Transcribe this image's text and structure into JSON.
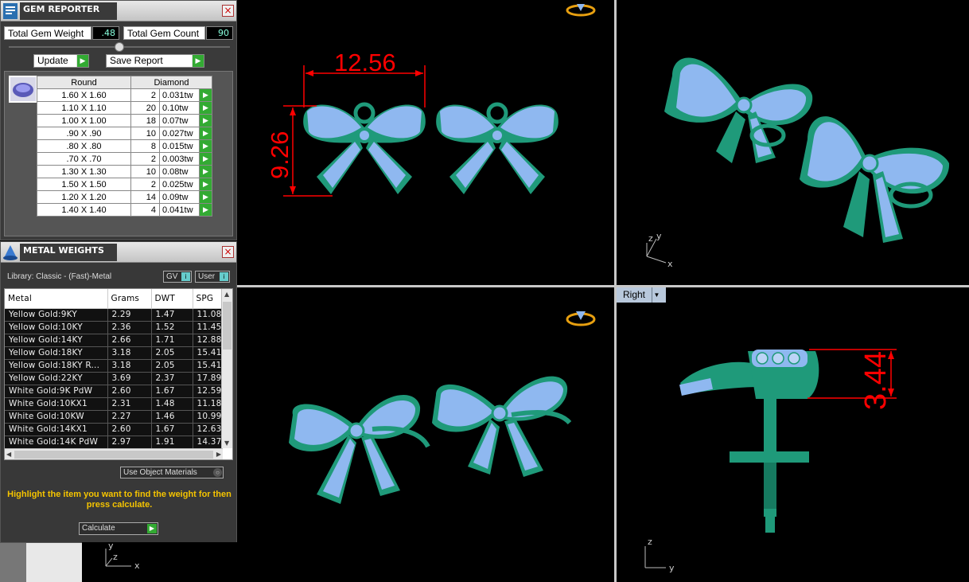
{
  "gem_reporter": {
    "title": "GEM REPORTER",
    "total_weight_label": "Total Gem Weight",
    "total_weight_value": ".48",
    "total_count_label": "Total Gem Count",
    "total_count_value": "90",
    "update_label": "Update",
    "save_report_label": "Save Report",
    "table_header_shape": "Round",
    "table_header_type": "Diamond",
    "rows": [
      {
        "size": "1.60 X 1.60",
        "count": "2",
        "tw": "0.031tw"
      },
      {
        "size": "1.10 X 1.10",
        "count": "20",
        "tw": "0.10tw"
      },
      {
        "size": "1.00 X 1.00",
        "count": "18",
        "tw": "0.07tw"
      },
      {
        "size": ".90 X .90",
        "count": "10",
        "tw": "0.027tw"
      },
      {
        "size": ".80 X .80",
        "count": "8",
        "tw": "0.015tw"
      },
      {
        "size": ".70 X .70",
        "count": "2",
        "tw": "0.003tw"
      },
      {
        "size": "1.30 X 1.30",
        "count": "10",
        "tw": "0.08tw"
      },
      {
        "size": "1.50 X 1.50",
        "count": "2",
        "tw": "0.025tw"
      },
      {
        "size": "1.20 X 1.20",
        "count": "14",
        "tw": "0.09tw"
      },
      {
        "size": "1.40 X 1.40",
        "count": "4",
        "tw": "0.041tw"
      }
    ]
  },
  "metal_weights": {
    "title": "METAL WEIGHTS",
    "library_text": "Library: Classic - (Fast)-Metal",
    "gv_label": "GV",
    "user_label": "User",
    "columns": [
      "Metal",
      "Grams",
      "DWT",
      "SPG"
    ],
    "rows": [
      {
        "metal": "Yellow Gold:9KY",
        "grams": "2.29",
        "dwt": "1.47",
        "spg": "11.08"
      },
      {
        "metal": "Yellow Gold:10KY",
        "grams": "2.36",
        "dwt": "1.52",
        "spg": "11.45"
      },
      {
        "metal": "Yellow Gold:14KY",
        "grams": "2.66",
        "dwt": "1.71",
        "spg": "12.88"
      },
      {
        "metal": "Yellow Gold:18KY",
        "grams": "3.18",
        "dwt": "2.05",
        "spg": "15.41"
      },
      {
        "metal": "Yellow Gold:18KY R...",
        "grams": "3.18",
        "dwt": "2.05",
        "spg": "15.41"
      },
      {
        "metal": "Yellow Gold:22KY",
        "grams": "3.69",
        "dwt": "2.37",
        "spg": "17.89"
      },
      {
        "metal": "White Gold:9K PdW",
        "grams": "2.60",
        "dwt": "1.67",
        "spg": "12.59"
      },
      {
        "metal": "White Gold:10KX1",
        "grams": "2.31",
        "dwt": "1.48",
        "spg": "11.18"
      },
      {
        "metal": "White Gold:10KW",
        "grams": "2.27",
        "dwt": "1.46",
        "spg": "10.99"
      },
      {
        "metal": "White Gold:14KX1",
        "grams": "2.60",
        "dwt": "1.67",
        "spg": "12.63"
      },
      {
        "metal": "White Gold:14K PdW",
        "grams": "2.97",
        "dwt": "1.91",
        "spg": "14.37"
      }
    ],
    "use_object_materials_label": "Use Object Materials",
    "hint": "Highlight the item you want to find the weight for then press calculate.",
    "calculate_label": "Calculate"
  },
  "viewports": {
    "top": {
      "dim_width": "12.56",
      "dim_height": "9.26"
    },
    "right": {
      "label": "Right",
      "dim_height": "3.44"
    },
    "axes": {
      "x": "x",
      "y": "y",
      "z": "z"
    }
  },
  "colors": {
    "metal": "#1f9a7a",
    "gem": "#8fb8f0",
    "dimension": "#ff0000",
    "hint": "#f5c400"
  }
}
